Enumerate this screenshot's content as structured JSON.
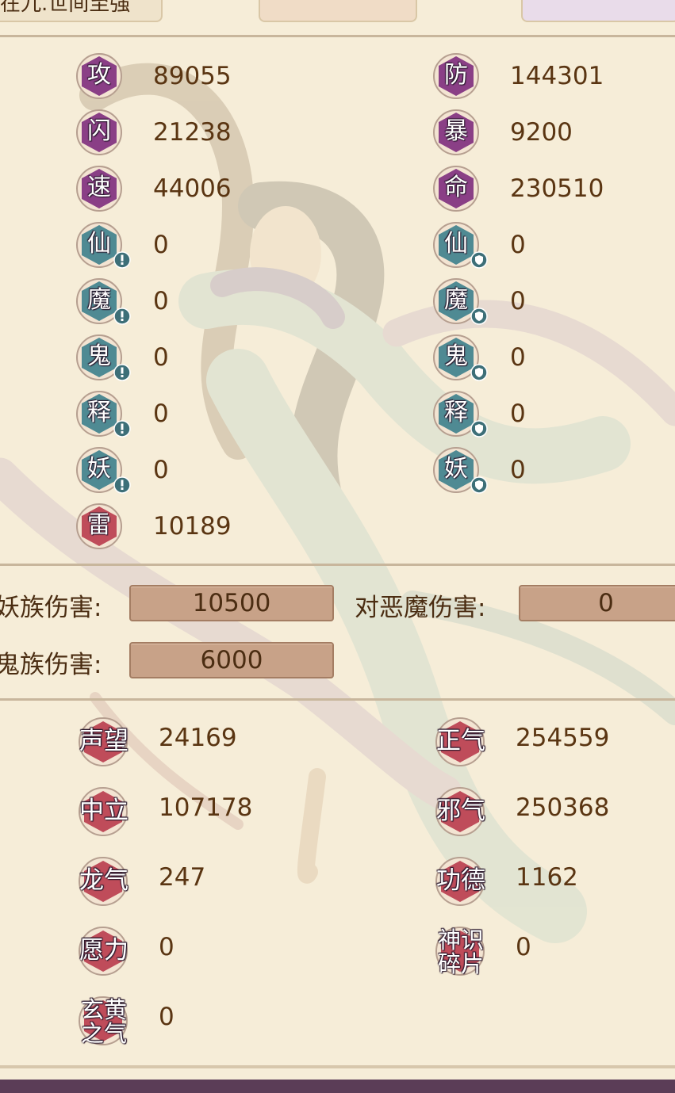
{
  "header": {
    "active_tab_label": "在九.世间至强"
  },
  "stats": [
    {
      "glyph": "攻",
      "value": "89055",
      "tone": "purple",
      "icon": "none"
    },
    {
      "glyph": "防",
      "value": "144301",
      "tone": "purple",
      "icon": "none"
    },
    {
      "glyph": "闪",
      "value": "21238",
      "tone": "purple",
      "icon": "none"
    },
    {
      "glyph": "暴",
      "value": "9200",
      "tone": "purple",
      "icon": "none"
    },
    {
      "glyph": "速",
      "value": "44006",
      "tone": "purple",
      "icon": "none"
    },
    {
      "glyph": "命",
      "value": "230510",
      "tone": "purple",
      "icon": "none"
    },
    {
      "glyph": "仙",
      "value": "0",
      "tone": "teal",
      "icon": "attack-alert-icon"
    },
    {
      "glyph": "仙",
      "value": "0",
      "tone": "teal",
      "icon": "shield-icon"
    },
    {
      "glyph": "魔",
      "value": "0",
      "tone": "teal",
      "icon": "attack-alert-icon"
    },
    {
      "glyph": "魔",
      "value": "0",
      "tone": "teal",
      "icon": "shield-icon"
    },
    {
      "glyph": "鬼",
      "value": "0",
      "tone": "teal",
      "icon": "attack-alert-icon"
    },
    {
      "glyph": "鬼",
      "value": "0",
      "tone": "teal",
      "icon": "shield-icon"
    },
    {
      "glyph": "释",
      "value": "0",
      "tone": "teal",
      "icon": "attack-alert-icon"
    },
    {
      "glyph": "释",
      "value": "0",
      "tone": "teal",
      "icon": "shield-icon"
    },
    {
      "glyph": "妖",
      "value": "0",
      "tone": "teal",
      "icon": "attack-alert-icon"
    },
    {
      "glyph": "妖",
      "value": "0",
      "tone": "teal",
      "icon": "shield-icon"
    },
    {
      "glyph": "雷",
      "value": "10189",
      "tone": "red",
      "icon": "none"
    }
  ],
  "damage": [
    {
      "label": "妖族伤害:",
      "value": "10500"
    },
    {
      "label": "对恶魔伤害:",
      "value": "0"
    },
    {
      "label": "鬼族伤害:",
      "value": "6000"
    }
  ],
  "attributes": [
    {
      "label": "声望",
      "value": "24169"
    },
    {
      "label": "正气",
      "value": "254559"
    },
    {
      "label": "中立",
      "value": "107178"
    },
    {
      "label": "邪气",
      "value": "250368"
    },
    {
      "label": "龙气",
      "value": "247"
    },
    {
      "label": "功德",
      "value": "1162"
    },
    {
      "label": "愿力",
      "value": "0"
    },
    {
      "label_lines": [
        "神识",
        "碎片"
      ],
      "value": "0"
    },
    {
      "label_lines": [
        "玄黄",
        "之气"
      ],
      "value": "0"
    }
  ],
  "colors": {
    "purple": "#8a3f86",
    "teal": "#4f8a93",
    "red": "#bf4c5a",
    "text": "#5a3512",
    "bar": "#c8a288",
    "bottom_bar": "#5b3d57"
  }
}
